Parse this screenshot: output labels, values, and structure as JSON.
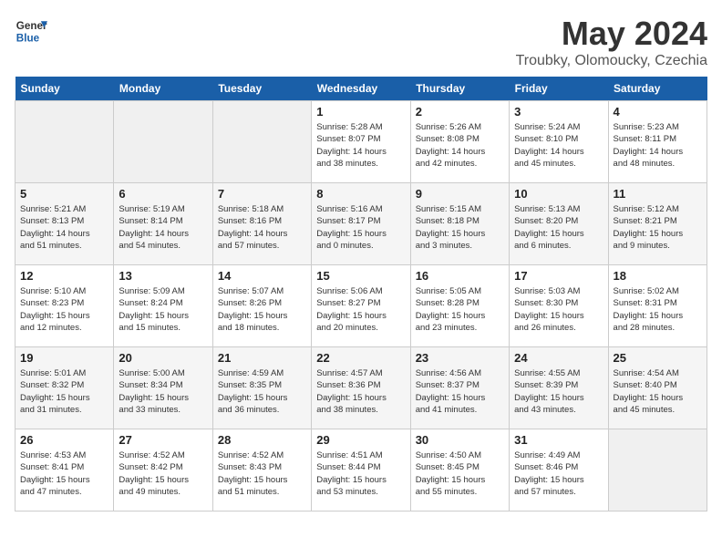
{
  "header": {
    "title": "May 2024",
    "location": "Troubky, Olomoucky, Czechia",
    "logo_general": "General",
    "logo_blue": "Blue"
  },
  "days_of_week": [
    "Sunday",
    "Monday",
    "Tuesday",
    "Wednesday",
    "Thursday",
    "Friday",
    "Saturday"
  ],
  "weeks": [
    [
      {
        "day": "",
        "info": ""
      },
      {
        "day": "",
        "info": ""
      },
      {
        "day": "",
        "info": ""
      },
      {
        "day": "1",
        "info": "Sunrise: 5:28 AM\nSunset: 8:07 PM\nDaylight: 14 hours\nand 38 minutes."
      },
      {
        "day": "2",
        "info": "Sunrise: 5:26 AM\nSunset: 8:08 PM\nDaylight: 14 hours\nand 42 minutes."
      },
      {
        "day": "3",
        "info": "Sunrise: 5:24 AM\nSunset: 8:10 PM\nDaylight: 14 hours\nand 45 minutes."
      },
      {
        "day": "4",
        "info": "Sunrise: 5:23 AM\nSunset: 8:11 PM\nDaylight: 14 hours\nand 48 minutes."
      }
    ],
    [
      {
        "day": "5",
        "info": "Sunrise: 5:21 AM\nSunset: 8:13 PM\nDaylight: 14 hours\nand 51 minutes."
      },
      {
        "day": "6",
        "info": "Sunrise: 5:19 AM\nSunset: 8:14 PM\nDaylight: 14 hours\nand 54 minutes."
      },
      {
        "day": "7",
        "info": "Sunrise: 5:18 AM\nSunset: 8:16 PM\nDaylight: 14 hours\nand 57 minutes."
      },
      {
        "day": "8",
        "info": "Sunrise: 5:16 AM\nSunset: 8:17 PM\nDaylight: 15 hours\nand 0 minutes."
      },
      {
        "day": "9",
        "info": "Sunrise: 5:15 AM\nSunset: 8:18 PM\nDaylight: 15 hours\nand 3 minutes."
      },
      {
        "day": "10",
        "info": "Sunrise: 5:13 AM\nSunset: 8:20 PM\nDaylight: 15 hours\nand 6 minutes."
      },
      {
        "day": "11",
        "info": "Sunrise: 5:12 AM\nSunset: 8:21 PM\nDaylight: 15 hours\nand 9 minutes."
      }
    ],
    [
      {
        "day": "12",
        "info": "Sunrise: 5:10 AM\nSunset: 8:23 PM\nDaylight: 15 hours\nand 12 minutes."
      },
      {
        "day": "13",
        "info": "Sunrise: 5:09 AM\nSunset: 8:24 PM\nDaylight: 15 hours\nand 15 minutes."
      },
      {
        "day": "14",
        "info": "Sunrise: 5:07 AM\nSunset: 8:26 PM\nDaylight: 15 hours\nand 18 minutes."
      },
      {
        "day": "15",
        "info": "Sunrise: 5:06 AM\nSunset: 8:27 PM\nDaylight: 15 hours\nand 20 minutes."
      },
      {
        "day": "16",
        "info": "Sunrise: 5:05 AM\nSunset: 8:28 PM\nDaylight: 15 hours\nand 23 minutes."
      },
      {
        "day": "17",
        "info": "Sunrise: 5:03 AM\nSunset: 8:30 PM\nDaylight: 15 hours\nand 26 minutes."
      },
      {
        "day": "18",
        "info": "Sunrise: 5:02 AM\nSunset: 8:31 PM\nDaylight: 15 hours\nand 28 minutes."
      }
    ],
    [
      {
        "day": "19",
        "info": "Sunrise: 5:01 AM\nSunset: 8:32 PM\nDaylight: 15 hours\nand 31 minutes."
      },
      {
        "day": "20",
        "info": "Sunrise: 5:00 AM\nSunset: 8:34 PM\nDaylight: 15 hours\nand 33 minutes."
      },
      {
        "day": "21",
        "info": "Sunrise: 4:59 AM\nSunset: 8:35 PM\nDaylight: 15 hours\nand 36 minutes."
      },
      {
        "day": "22",
        "info": "Sunrise: 4:57 AM\nSunset: 8:36 PM\nDaylight: 15 hours\nand 38 minutes."
      },
      {
        "day": "23",
        "info": "Sunrise: 4:56 AM\nSunset: 8:37 PM\nDaylight: 15 hours\nand 41 minutes."
      },
      {
        "day": "24",
        "info": "Sunrise: 4:55 AM\nSunset: 8:39 PM\nDaylight: 15 hours\nand 43 minutes."
      },
      {
        "day": "25",
        "info": "Sunrise: 4:54 AM\nSunset: 8:40 PM\nDaylight: 15 hours\nand 45 minutes."
      }
    ],
    [
      {
        "day": "26",
        "info": "Sunrise: 4:53 AM\nSunset: 8:41 PM\nDaylight: 15 hours\nand 47 minutes."
      },
      {
        "day": "27",
        "info": "Sunrise: 4:52 AM\nSunset: 8:42 PM\nDaylight: 15 hours\nand 49 minutes."
      },
      {
        "day": "28",
        "info": "Sunrise: 4:52 AM\nSunset: 8:43 PM\nDaylight: 15 hours\nand 51 minutes."
      },
      {
        "day": "29",
        "info": "Sunrise: 4:51 AM\nSunset: 8:44 PM\nDaylight: 15 hours\nand 53 minutes."
      },
      {
        "day": "30",
        "info": "Sunrise: 4:50 AM\nSunset: 8:45 PM\nDaylight: 15 hours\nand 55 minutes."
      },
      {
        "day": "31",
        "info": "Sunrise: 4:49 AM\nSunset: 8:46 PM\nDaylight: 15 hours\nand 57 minutes."
      },
      {
        "day": "",
        "info": ""
      }
    ]
  ]
}
